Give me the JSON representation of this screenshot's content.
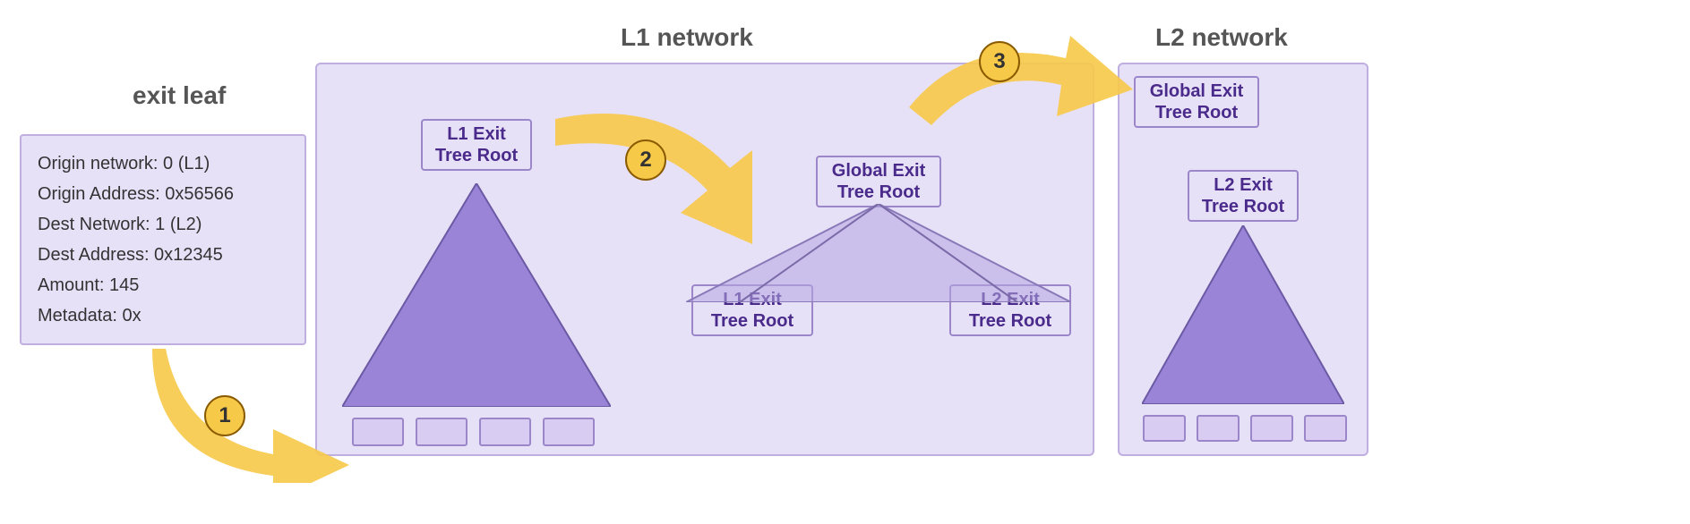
{
  "titles": {
    "exit_leaf": "exit leaf",
    "l1_network": "L1 network",
    "l2_network": "L2 network"
  },
  "leaf": {
    "origin_network": "Origin network: 0 (L1)",
    "origin_address": "Origin Address: 0x56566",
    "dest_network": "Dest Network: 1 (L2)",
    "dest_address": "Dest Address: 0x12345",
    "amount": "Amount: 145",
    "metadata": "Metadata: 0x"
  },
  "nodes": {
    "l1_root": "L1 Exit\nTree Root",
    "l1_tree": "L1 Exit\nTree",
    "global_root": "Global Exit\nTree Root",
    "l1_root_2": "L1 Exit\nTree Root",
    "l2_root_2": "L2 Exit\nTree Root",
    "global_root_2": "Global Exit\nTree Root",
    "l2_root": "L2 Exit\nTree Root",
    "l2_tree": "L2 Exit\nTree"
  },
  "steps": {
    "s1": "1",
    "s2": "2",
    "s3": "3"
  },
  "colors": {
    "panel_fill": "#e7e1f8",
    "panel_border": "#bfaee0",
    "node_border": "#9b86c9",
    "tri_fill": "#9a84d8",
    "tri_fill_light": "#b5a6e0",
    "arrow_fill": "#f7c948",
    "text_dark": "#4a2a8a"
  }
}
